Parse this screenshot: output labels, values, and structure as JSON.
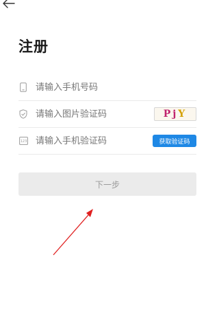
{
  "title": "注册",
  "fields": {
    "phone": {
      "placeholder": "请输入手机号码",
      "icon": "phone-icon"
    },
    "image_code": {
      "placeholder": "请输入图片验证码",
      "icon": "shield-icon",
      "captcha_text": [
        "Pj",
        "Y"
      ]
    },
    "sms_code": {
      "placeholder": "请输入手机验证码",
      "icon": "keypad-icon",
      "get_code_label": "获取验证码"
    }
  },
  "next_button_label": "下一步",
  "colors": {
    "primary": "#1e88e5",
    "disabled_button_bg": "#ebebeb",
    "annotation_arrow": "#e02020"
  }
}
